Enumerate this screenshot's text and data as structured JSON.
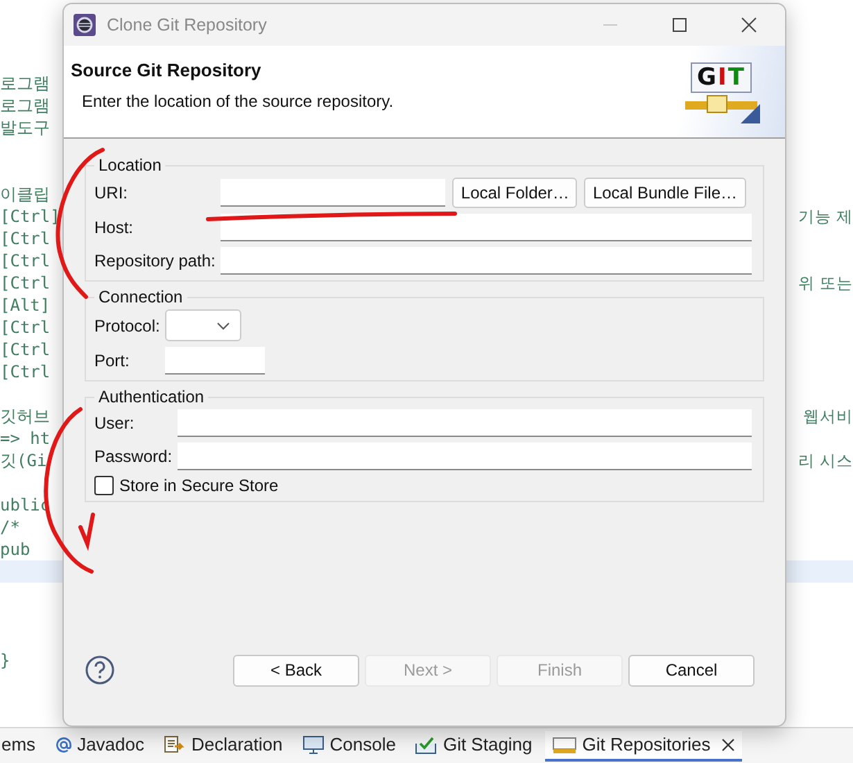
{
  "editor": {
    "lines": [
      {
        "left": "로그램",
        "highlighted": false
      },
      {
        "left": "로그램",
        "highlighted": false
      },
      {
        "left": "발도구",
        "highlighted": false
      },
      {
        "highlighted": false
      },
      {
        "highlighted": false
      },
      {
        "left": "이클립",
        "highlighted": false
      },
      {
        "left": "[Ctrl]",
        "right": "기능 제",
        "highlighted": false
      },
      {
        "left": "[Ctrl",
        "highlighted": false
      },
      {
        "left": "[Ctrl",
        "highlighted": false
      },
      {
        "left": "[Ctrl",
        "right": "위 또는",
        "highlighted": false
      },
      {
        "left": "[Alt]",
        "highlighted": false
      },
      {
        "left": "[Ctrl",
        "highlighted": false
      },
      {
        "left": "[Ctrl",
        "highlighted": false
      },
      {
        "left": "[Ctrl",
        "highlighted": false
      },
      {
        "highlighted": false
      },
      {
        "left": "깃허브",
        "right": "웹서비",
        "highlighted": false
      },
      {
        "left": "=> ht",
        "highlighted": false
      },
      {
        "left": "깃(Gi",
        "right": "리 시스",
        "highlighted": false
      },
      {
        "highlighted": false
      },
      {
        "left": "ublic",
        "highlighted": false
      },
      {
        "left": "/*",
        "highlighted": false
      },
      {
        "left": "pub",
        "highlighted": false
      },
      {
        "highlighted": true
      },
      {
        "highlighted": false
      },
      {
        "highlighted": false
      },
      {
        "highlighted": false
      },
      {
        "left": "}",
        "highlighted": false
      }
    ]
  },
  "bottom_tabs": [
    {
      "label": "ems",
      "kind": "plain",
      "selected": false
    },
    {
      "label": "Javadoc",
      "kind": "at",
      "selected": false
    },
    {
      "label": "Declaration",
      "kind": "declaration",
      "selected": false
    },
    {
      "label": "Console",
      "kind": "console",
      "selected": false
    },
    {
      "label": "Git Staging",
      "kind": "staging",
      "selected": false
    },
    {
      "label": "Git Repositories",
      "kind": "repositories",
      "selected": true
    }
  ],
  "dialog": {
    "title": "Clone Git Repository",
    "header": {
      "title": "Source Git Repository",
      "description": "Enter the location of the source repository.",
      "logo": [
        {
          "letter": "G",
          "color": "#111111"
        },
        {
          "letter": "I",
          "color": "#cc1010"
        },
        {
          "letter": "T",
          "color": "#108a10"
        }
      ]
    },
    "groups": [
      {
        "title": "Location",
        "fields": [
          {
            "label": "URI:",
            "kind": "text",
            "buttons": [
              "Local Folder…",
              "Local Bundle File…"
            ]
          },
          {
            "label": "Host:",
            "kind": "text"
          },
          {
            "label": "Repository path:",
            "kind": "text"
          }
        ]
      },
      {
        "title": "Connection",
        "fields": [
          {
            "label": "Protocol:",
            "kind": "dropdown"
          },
          {
            "label": "Port:",
            "kind": "short"
          }
        ]
      },
      {
        "title": "Authentication",
        "fields": [
          {
            "label": "User:",
            "kind": "text"
          },
          {
            "label": "Password:",
            "kind": "text"
          }
        ],
        "checkbox": {
          "label": "Store in Secure Store",
          "checked": false
        }
      }
    ],
    "buttons": [
      {
        "label": "< Back",
        "disabled": false
      },
      {
        "label": "Next >",
        "disabled": true
      },
      {
        "label": "Finish",
        "disabled": true
      },
      {
        "label": "Cancel",
        "disabled": false
      }
    ]
  }
}
